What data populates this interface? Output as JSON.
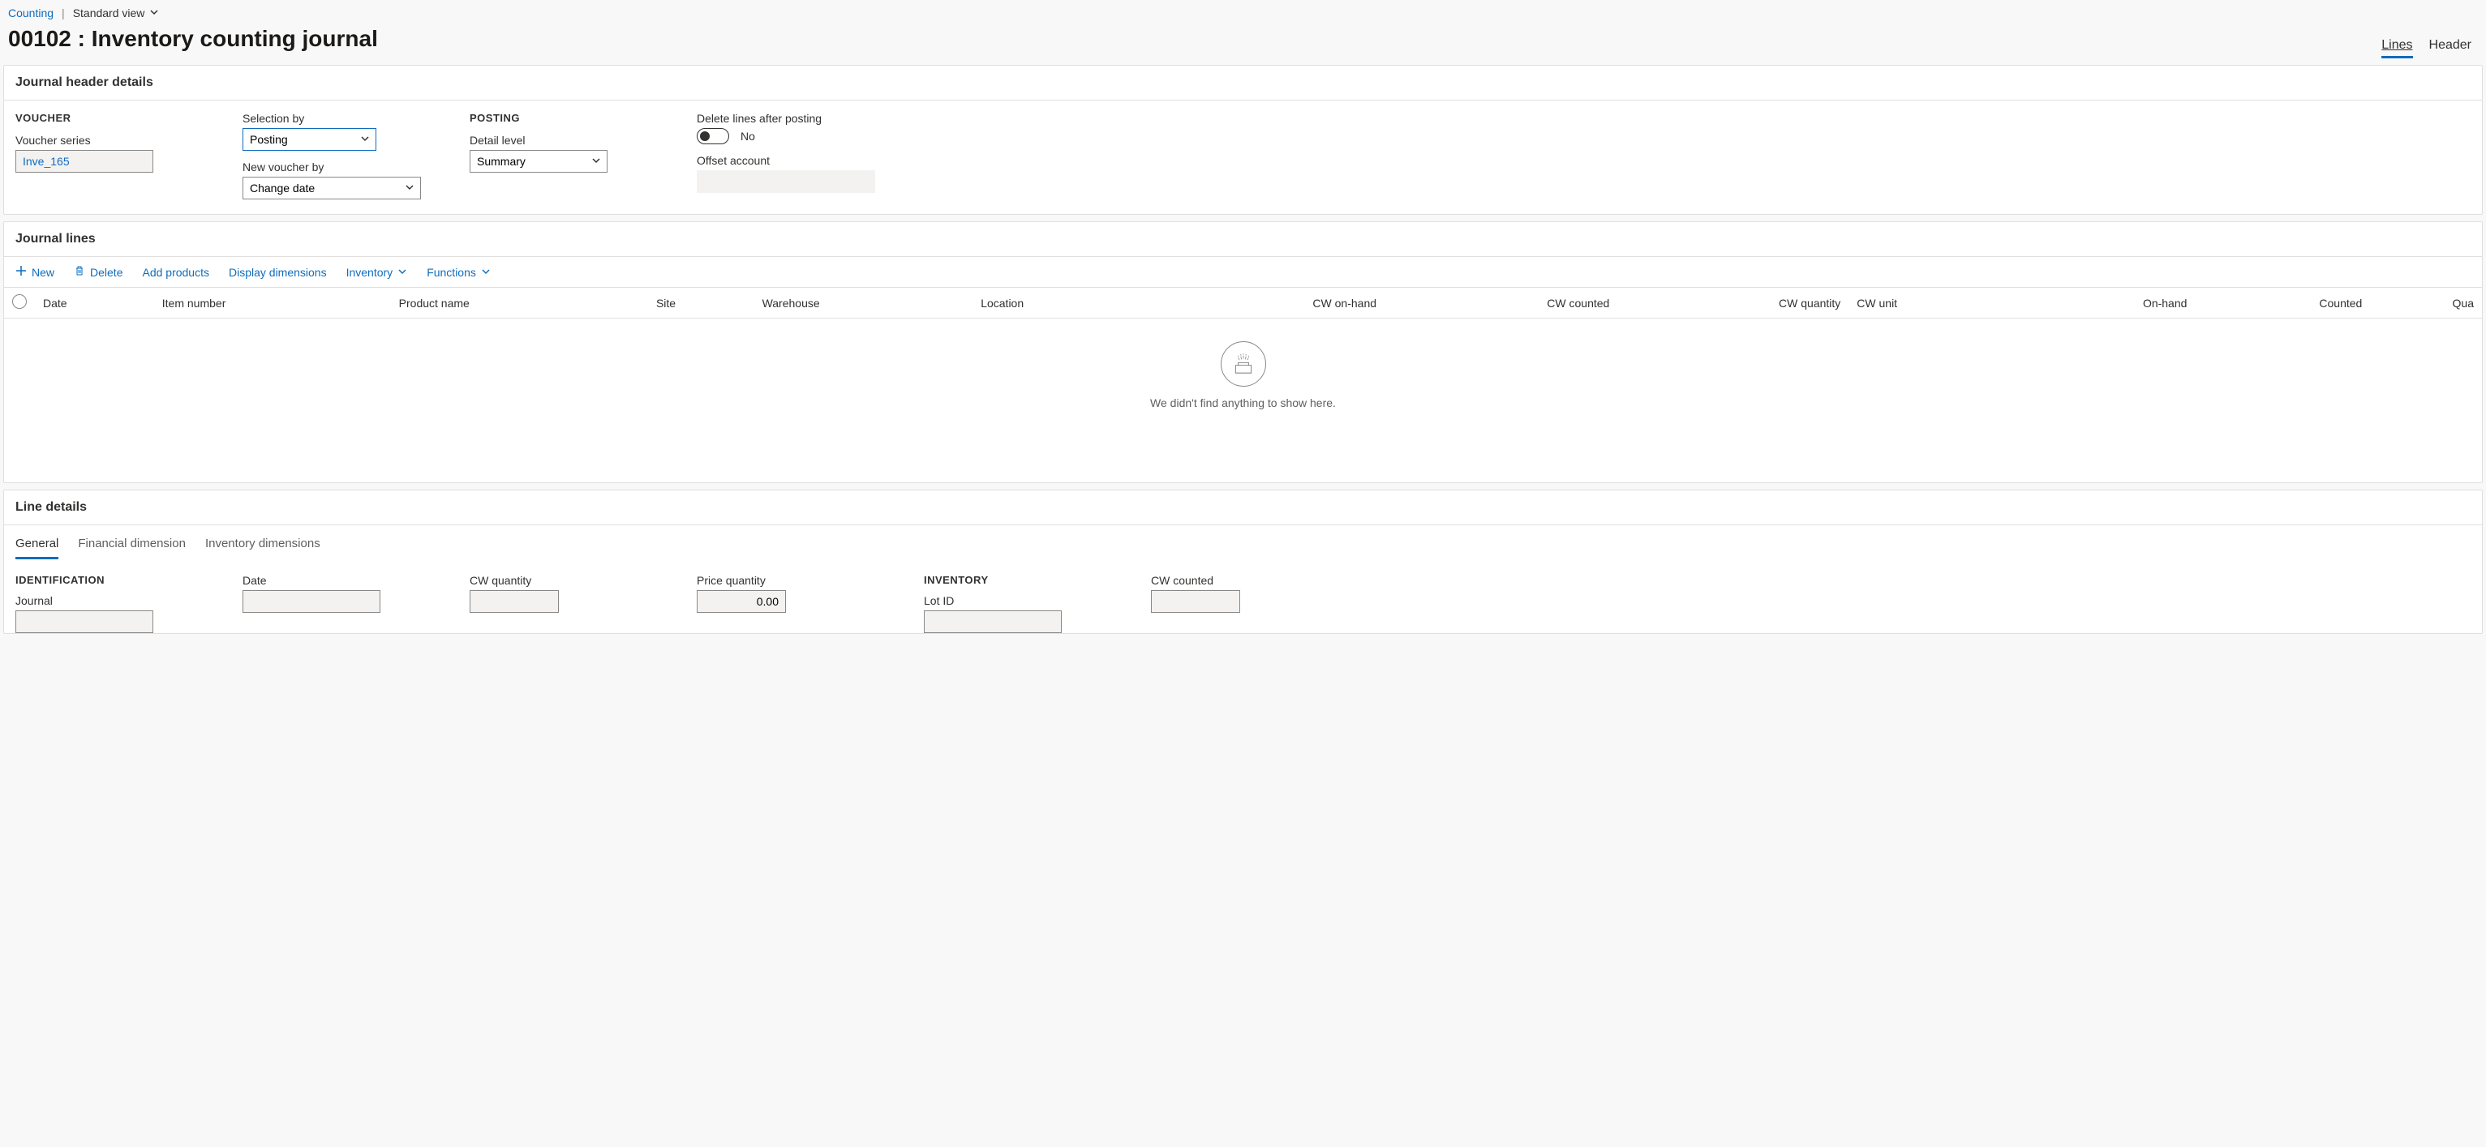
{
  "breadcrumb": {
    "link": "Counting",
    "view_label": "Standard view"
  },
  "page_title": "00102 : Inventory counting journal",
  "top_tabs": {
    "lines": "Lines",
    "header": "Header"
  },
  "journal_header": {
    "title": "Journal header details",
    "voucher": {
      "group_title": "VOUCHER",
      "series_label": "Voucher series",
      "series_value": "Inve_165",
      "selection_by_label": "Selection by",
      "selection_by_value": "Posting",
      "new_voucher_label": "New voucher by",
      "new_voucher_value": "Change date"
    },
    "posting": {
      "group_title": "POSTING",
      "detail_level_label": "Detail level",
      "detail_level_value": "Summary",
      "delete_lines_label": "Delete lines after posting",
      "delete_lines_value": "No",
      "offset_label": "Offset account",
      "offset_value": ""
    }
  },
  "journal_lines": {
    "title": "Journal lines",
    "toolbar": {
      "new": "New",
      "delete": "Delete",
      "add_products": "Add products",
      "display_dimensions": "Display dimensions",
      "inventory": "Inventory",
      "functions": "Functions"
    },
    "columns": {
      "date": "Date",
      "item_number": "Item number",
      "product_name": "Product name",
      "site": "Site",
      "warehouse": "Warehouse",
      "location": "Location",
      "cw_onhand": "CW on-hand",
      "cw_counted": "CW counted",
      "cw_quantity": "CW quantity",
      "cw_unit": "CW unit",
      "onhand": "On-hand",
      "counted": "Counted",
      "quantity": "Qua"
    },
    "empty_message": "We didn't find anything to show here."
  },
  "line_details": {
    "title": "Line details",
    "tabs": {
      "general": "General",
      "financial": "Financial dimension",
      "inventory_dims": "Inventory dimensions"
    },
    "identification": {
      "group_title": "IDENTIFICATION",
      "journal_label": "Journal",
      "date_label": "Date",
      "cw_quantity_label": "CW quantity",
      "price_quantity_label": "Price quantity",
      "price_quantity_value": "0.00"
    },
    "inventory": {
      "group_title": "INVENTORY",
      "lot_id_label": "Lot ID",
      "cw_counted_label": "CW counted"
    }
  }
}
